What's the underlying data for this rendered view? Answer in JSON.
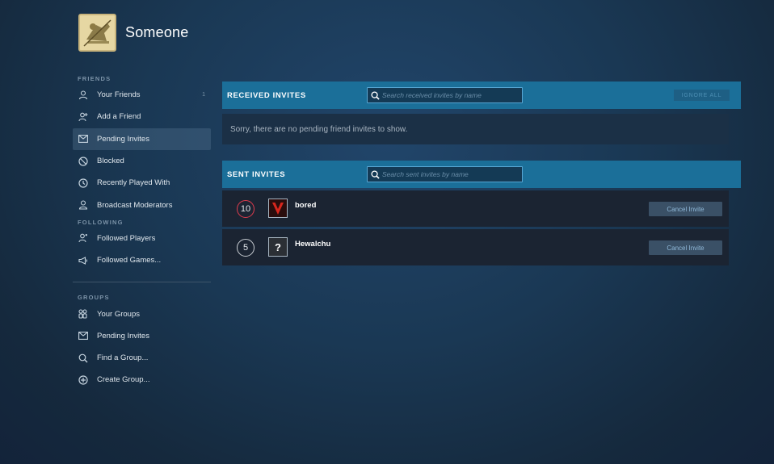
{
  "profile": {
    "name": "Someone",
    "avatar_icon": "game-art-avatar"
  },
  "sidebar": {
    "friends": {
      "title": "FRIENDS",
      "items": [
        {
          "label": "Your Friends",
          "icon": "person-icon",
          "count": "1"
        },
        {
          "label": "Add a Friend",
          "icon": "add-person-icon"
        },
        {
          "label": "Pending Invites",
          "icon": "envelope-icon",
          "active": true
        },
        {
          "label": "Blocked",
          "icon": "blocked-icon"
        },
        {
          "label": "Recently Played With",
          "icon": "clock-icon"
        },
        {
          "label": "Broadcast Moderators",
          "icon": "moderator-icon"
        }
      ]
    },
    "following": {
      "title": "FOLLOWING",
      "items": [
        {
          "label": "Followed Players",
          "icon": "followed-person-icon"
        },
        {
          "label": "Followed Games...",
          "icon": "megaphone-icon"
        }
      ]
    },
    "groups": {
      "title": "GROUPS",
      "items": [
        {
          "label": "Your Groups",
          "icon": "group-icon"
        },
        {
          "label": "Pending Invites",
          "icon": "envelope-icon"
        },
        {
          "label": "Find a Group...",
          "icon": "search-icon"
        },
        {
          "label": "Create Group...",
          "icon": "plus-circle-icon"
        }
      ]
    }
  },
  "received": {
    "title": "RECEIVED INVITES",
    "search_placeholder": "Search received invites by name",
    "ignore_all": "IGNORE ALL",
    "empty_message": "Sorry, there are no pending friend invites to show."
  },
  "sent": {
    "title": "SENT INVITES",
    "search_placeholder": "Search sent invites by name",
    "invites": [
      {
        "level": "10",
        "name": "bored",
        "avatar_icon": "red-v-logo-icon",
        "level_color": "#e03c4e",
        "action": "Cancel Invite"
      },
      {
        "level": "5",
        "name": "Hewalchu",
        "avatar_icon": "question-mark-icon",
        "level_color": "#c9ced3",
        "action": "Cancel Invite"
      }
    ]
  },
  "colors": {
    "header_blue": "#1b6f99",
    "row_bg": "#1b2432",
    "button_bg": "#3a5066"
  }
}
